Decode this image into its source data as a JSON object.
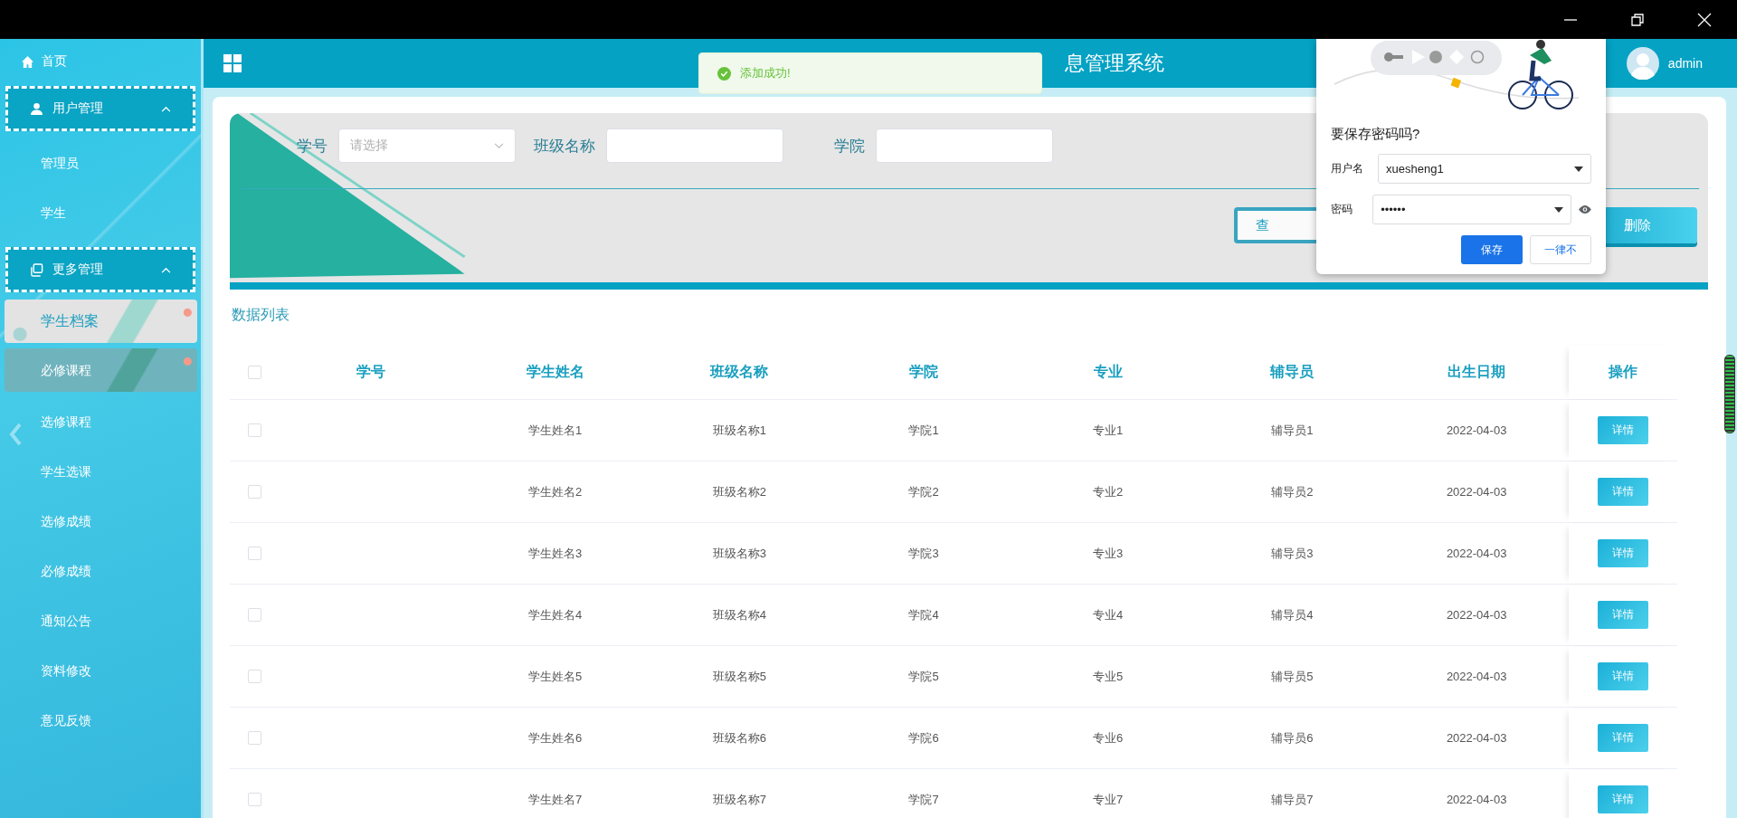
{
  "sidebar": {
    "home": "首页",
    "groups": [
      {
        "label": "用户管理",
        "kind": "user",
        "expanded": true,
        "items": [
          {
            "label": "管理员",
            "selected": false,
            "hovered": false
          },
          {
            "label": "学生",
            "selected": false,
            "hovered": false
          }
        ]
      },
      {
        "label": "更多管理",
        "kind": "copy",
        "expanded": true,
        "items": [
          {
            "label": "学生档案",
            "selected": true,
            "hovered": false
          },
          {
            "label": "必修课程",
            "selected": false,
            "hovered": true
          },
          {
            "label": "选修课程",
            "selected": false,
            "hovered": false
          },
          {
            "label": "学生选课",
            "selected": false,
            "hovered": false
          },
          {
            "label": "选修成绩",
            "selected": false,
            "hovered": false
          },
          {
            "label": "必修成绩",
            "selected": false,
            "hovered": false
          },
          {
            "label": "通知公告",
            "selected": false,
            "hovered": false
          },
          {
            "label": "资料修改",
            "selected": false,
            "hovered": false
          },
          {
            "label": "意见反馈",
            "selected": false,
            "hovered": false
          }
        ]
      }
    ]
  },
  "header": {
    "title": "息管理系统",
    "user": "admin"
  },
  "toast": {
    "message": "添加成功!"
  },
  "filter": {
    "fields": [
      {
        "label": "学号",
        "kind": "select",
        "placeholder": "请选择"
      },
      {
        "label": "班级名称",
        "kind": "input"
      },
      {
        "label": "学院",
        "kind": "input"
      }
    ],
    "buttons": [
      {
        "label": "查",
        "kind": "query"
      },
      {
        "label": "删除",
        "kind": "delete"
      }
    ]
  },
  "list_title": "数据列表",
  "table": {
    "all_checked": false,
    "columns": [
      "学号",
      "学生姓名",
      "班级名称",
      "学院",
      "专业",
      "辅导员",
      "出生日期",
      "操作"
    ],
    "rows": [
      {
        "checked": false,
        "cells": [
          "",
          "学生姓名1",
          "班级名称1",
          "学院1",
          "专业1",
          "辅导员1",
          "2022-04-03"
        ],
        "action": "详情"
      },
      {
        "checked": false,
        "cells": [
          "",
          "学生姓名2",
          "班级名称2",
          "学院2",
          "专业2",
          "辅导员2",
          "2022-04-03"
        ],
        "action": "详情"
      },
      {
        "checked": false,
        "cells": [
          "",
          "学生姓名3",
          "班级名称3",
          "学院3",
          "专业3",
          "辅导员3",
          "2022-04-03"
        ],
        "action": "详情"
      },
      {
        "checked": false,
        "cells": [
          "",
          "学生姓名4",
          "班级名称4",
          "学院4",
          "专业4",
          "辅导员4",
          "2022-04-03"
        ],
        "action": "详情"
      },
      {
        "checked": false,
        "cells": [
          "",
          "学生姓名5",
          "班级名称5",
          "学院5",
          "专业5",
          "辅导员5",
          "2022-04-03"
        ],
        "action": "详情"
      },
      {
        "checked": false,
        "cells": [
          "",
          "学生姓名6",
          "班级名称6",
          "学院6",
          "专业6",
          "辅导员6",
          "2022-04-03"
        ],
        "action": "详情"
      },
      {
        "checked": false,
        "cells": [
          "",
          "学生姓名7",
          "班级名称7",
          "学院7",
          "专业7",
          "辅导员7",
          "2022-04-03"
        ],
        "action": "详情"
      }
    ]
  },
  "password_prompt": {
    "title": "要保存密码吗?",
    "username_label": "用户名",
    "username": "xuesheng1",
    "password_label": "密码",
    "password": "••••••",
    "buttons": [
      {
        "label": "保存",
        "kind": "primary"
      },
      {
        "label": "一律不",
        "kind": "secondary"
      }
    ]
  }
}
